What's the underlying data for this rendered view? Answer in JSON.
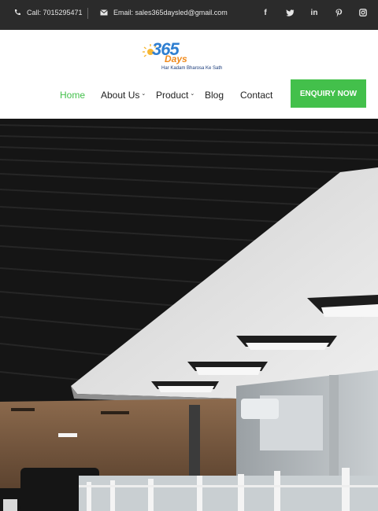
{
  "topbar": {
    "phone": "Call: 7015295471",
    "email": "Email: sales365daysled@gmail.com",
    "socials": [
      "facebook-icon",
      "twitter-icon",
      "linkedin-icon",
      "pinterest-icon",
      "instagram-icon"
    ]
  },
  "logo": {
    "number": "365",
    "word": "Days",
    "tagline": "Har Kadam Bharosa Ke Sath"
  },
  "nav": {
    "items": [
      {
        "label": "Home",
        "active": true
      },
      {
        "label": "About Us",
        "dropdown": true
      },
      {
        "label": "Product",
        "dropdown": true
      },
      {
        "label": "Blog"
      },
      {
        "label": "Contact"
      }
    ],
    "cta": "ENQUIRY NOW"
  },
  "colors": {
    "accent": "#43c04b",
    "topbar_bg": "#2b2b2b"
  }
}
